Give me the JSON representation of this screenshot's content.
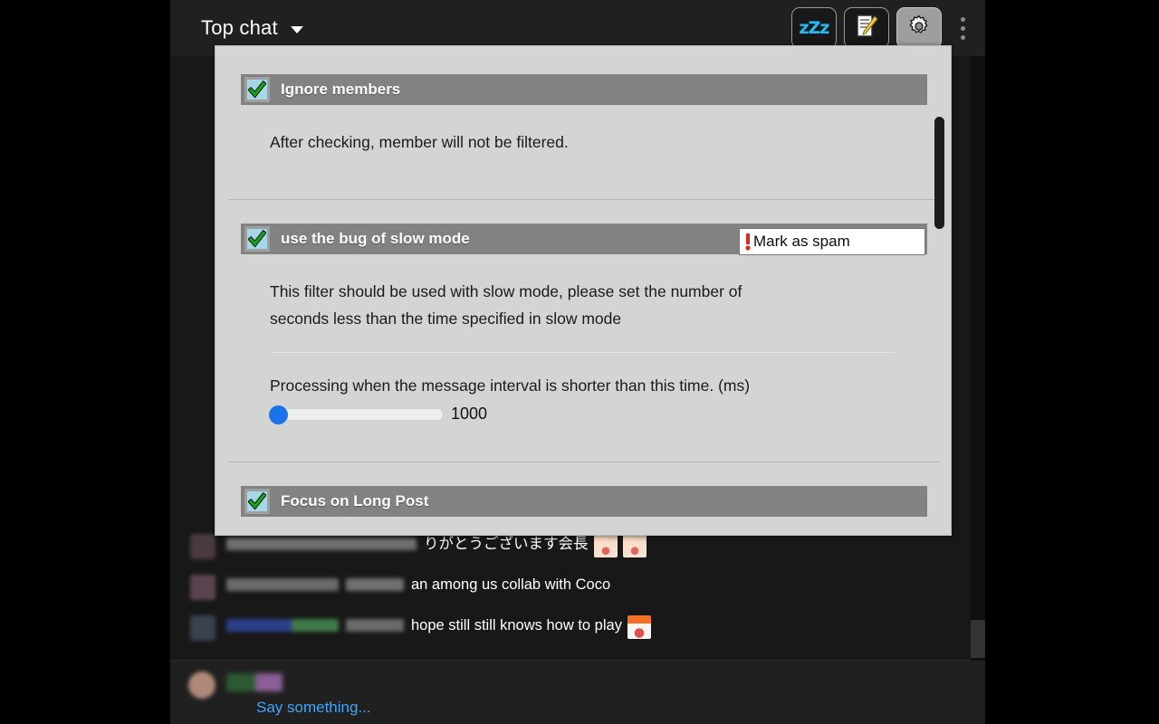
{
  "header": {
    "title": "Top chat",
    "dropdown_icon": "chevron-down-icon",
    "buttons": [
      {
        "name": "sleep-mode-button",
        "icon": "zzz-icon",
        "label": "zZz",
        "active": false
      },
      {
        "name": "memo-button",
        "icon": "memo-pencil-icon",
        "label": "",
        "active": false
      },
      {
        "name": "settings-button",
        "icon": "gear-icon",
        "label": "",
        "active": true
      }
    ],
    "overflow_menu_icon": "kebab-menu-icon"
  },
  "settings_panel": {
    "sections": [
      {
        "id": "ignore-members",
        "title": "Ignore members",
        "checked": true,
        "checkbox_icon": "green-check-icon",
        "description": "After checking, member will not be filtered.",
        "has_action": false
      },
      {
        "id": "slow-mode-bug",
        "title": "use the bug of slow mode",
        "checked": true,
        "checkbox_icon": "green-check-icon",
        "has_action": true,
        "action": {
          "icon": "red-exclamation-icon",
          "value": "Mark as spam"
        },
        "description_line1": "This filter should be used with slow mode, please set the number of",
        "description_line2": "seconds less than the time specified in slow mode",
        "slider": {
          "label": "Processing when the message interval is shorter than this time. (ms)",
          "value": "1000",
          "position_percent": 0
        }
      },
      {
        "id": "focus-long-post",
        "title": "Focus on Long Post",
        "checked": true,
        "checkbox_icon": "green-check-icon",
        "has_action": false
      }
    ],
    "scrollbar": {
      "name": "panel-scrollbar",
      "thumb_top_percent": 14
    }
  },
  "chat": {
    "messages": [
      {
        "avatar_color": "#4a3a40",
        "name_width": 210,
        "badge_width": 0,
        "text": "",
        "emoji": "",
        "partial": true
      },
      {
        "avatar_color": "#5a4450",
        "name_width": 124,
        "badge_width": 64,
        "text": "an among us collab with Coco",
        "emoji": ""
      },
      {
        "avatar_color": "#3a4250",
        "name_width": 124,
        "badge_width": 64,
        "text": "hope still still knows how to play",
        "emoji": "sticker-icon"
      }
    ],
    "composer_placeholder": "Say something..."
  }
}
